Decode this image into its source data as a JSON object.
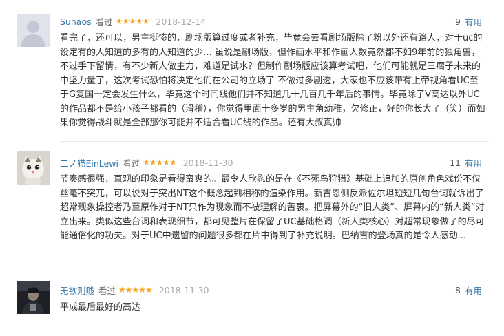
{
  "reviews": [
    {
      "user": "Suhaos",
      "status": "看过",
      "stars": "★★★★★",
      "date": "2018-12-14",
      "votes": "9",
      "vote_label": "有用",
      "content": "看完了，还可以，男主挺惨的，剧场版算过度或者补充，毕竟会去看剧场版除了粉以外还有路人，对于uc的设定有的人知道的多有的人知道的少… 虽说是剧场版，但作画水平和作画人数竟然都不如9年前的独角兽，不过手下留情，有不少新人做主力，难道是试水？但制作剧场版应该算考试吧，他们可能就是三瘸子未来的中坚力量了，这次考试恐怕将决定他们在公司的立场了 不做过多剧透，大家也不应该带有上帝视角看UC至于G复国一定会发生什么，毕竟这个时间线他们并不知道几十几百几千年后的事情。毕竟除了V高达以外UC的作品都不是给小孩子都看的（滑稽），你觉得里面十多岁的男主角幼稚，欠修正，好的你长大了（笑）而如果你觉得战斗就是全部那你可能并不适合看UC线的作品。还有大叔真帅"
    },
    {
      "user": "二ノ猫EinLewi",
      "status": "看过",
      "stars": "★★★★★",
      "date": "2018-11-30",
      "votes": "11",
      "vote_label": "有用",
      "content": "节奏感很强，直观的印象是看得蛮爽的。最令人欣慰的是在《不死鸟狩猎》基础上追加的原创角色戏份不仅丝毫不突兀，可以说对于突出NT这个概念起到相称的渲染作用。新吉恩侧反派佐尔坦短短几句台词就诉出了超常现象操控者乃至原作对于NT只作为现象而不被理解的苦衷。把屏幕外的“旧人类”、屏幕内的“新人类”对立出来。类似这些台词和表现细节，都可见整片在保留了UC基础格调（新人类核心）对超常现象做了的尽可能通俗化的功夫。对于UC中遗留的问题很多都在片中得到了补充说明。巴纳吉的登场真的是令人感动..."
    },
    {
      "user": "无欲则贱",
      "status": "看过",
      "stars": "★★★★★",
      "date": "2018-11-30",
      "votes": "8",
      "vote_label": "有用",
      "content": "平成最后最好的高达"
    }
  ]
}
